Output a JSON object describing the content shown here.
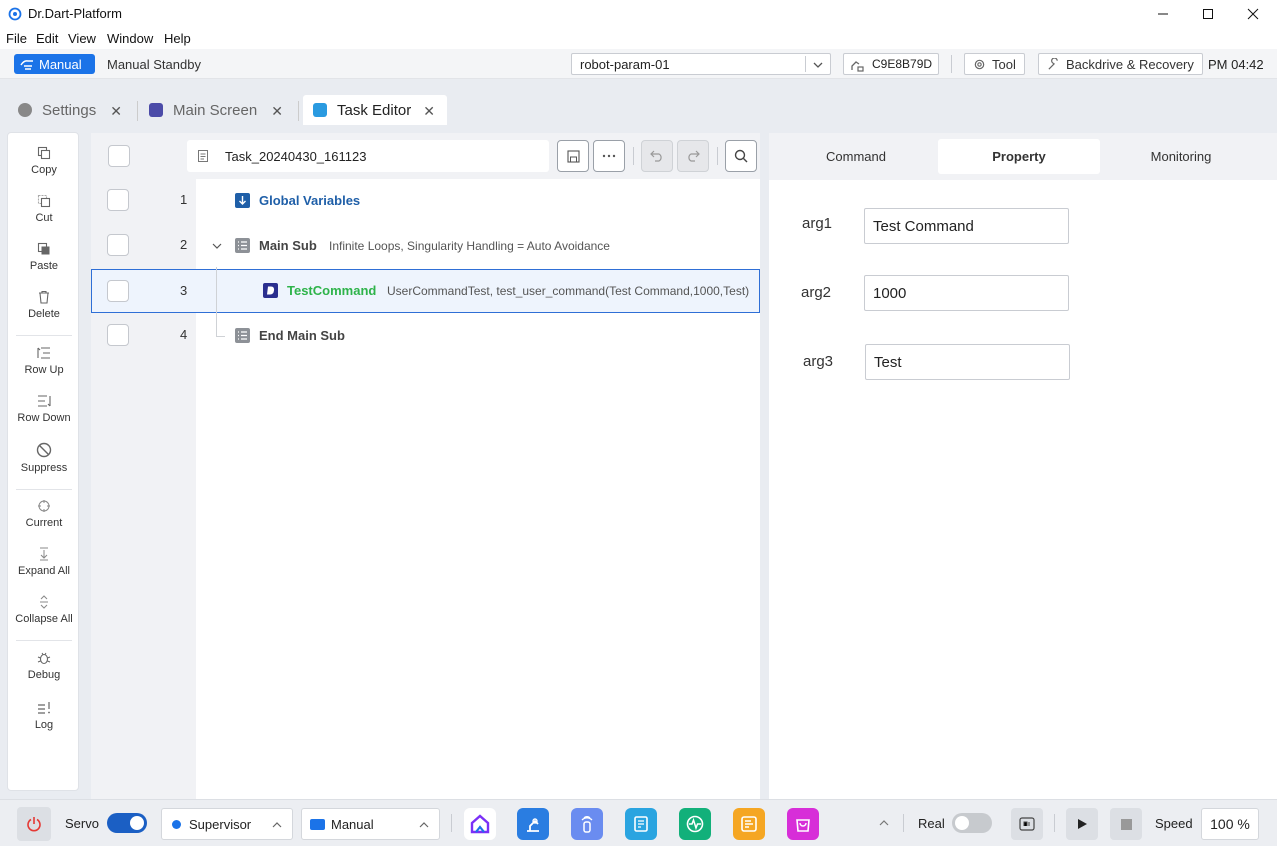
{
  "window": {
    "title": "Dr.Dart-Platform",
    "minimize_icon": "minimize-icon",
    "maximize_icon": "maximize-icon",
    "close_icon": "close-icon"
  },
  "menu": [
    "File",
    "Edit",
    "View",
    "Window",
    "Help"
  ],
  "status": {
    "mode_label": "Manual",
    "state_label": "Manual Standby",
    "robot_param": "robot-param-01",
    "serial": "C9E8B79D",
    "tool_label": "Tool",
    "backdrive_label": "Backdrive & Recovery",
    "clock": "PM 04:42",
    "accent_color": "#1b73e8"
  },
  "tabs": [
    {
      "label": "Settings",
      "icon": "settings-icon",
      "active": false
    },
    {
      "label": "Main Screen",
      "icon": "dart-logo-icon",
      "active": false
    },
    {
      "label": "Task Editor",
      "icon": "task-editor-icon",
      "active": true
    }
  ],
  "left_toolbar": {
    "copy": "Copy",
    "cut": "Cut",
    "paste": "Paste",
    "delete": "Delete",
    "row_up": "Row Up",
    "row_down": "Row Down",
    "suppress": "Suppress",
    "current": "Current",
    "expand_all": "Expand All",
    "collapse_all": "Collapse All",
    "debug": "Debug",
    "log": "Log"
  },
  "editor": {
    "task_name": "Task_20240430_161123",
    "rows": [
      {
        "num": "1",
        "label": "Global Variables",
        "desc": "",
        "label_color": "#1f5fa8",
        "icon": "arrow-down-icon"
      },
      {
        "num": "2",
        "label": "Main Sub",
        "desc": "Infinite Loops, Singularity Handling = Auto Avoidance",
        "label_color": "#444444",
        "icon": "list-icon"
      },
      {
        "num": "3",
        "label": "TestCommand",
        "desc": "UserCommandTest, test_user_command(Test Command,1000,Test)",
        "label_color": "#2eb34a",
        "icon": "dart-logo-icon",
        "selected": true
      },
      {
        "num": "4",
        "label": "End Main Sub",
        "desc": "",
        "label_color": "#444444",
        "icon": "list-icon"
      }
    ]
  },
  "right_panel": {
    "tabs": [
      "Command",
      "Property",
      "Monitoring"
    ],
    "active_tab": "Property",
    "args": [
      {
        "label": "arg1",
        "value": "Test Command"
      },
      {
        "label": "arg2",
        "value": "1000"
      },
      {
        "label": "arg3",
        "value": "Test"
      }
    ]
  },
  "bottom": {
    "servo_label": "Servo",
    "servo_on": true,
    "user_level": "Supervisor",
    "op_mode": "Manual",
    "real_label": "Real",
    "real_on": false,
    "speed_label": "Speed",
    "speed_value": "100 %"
  }
}
